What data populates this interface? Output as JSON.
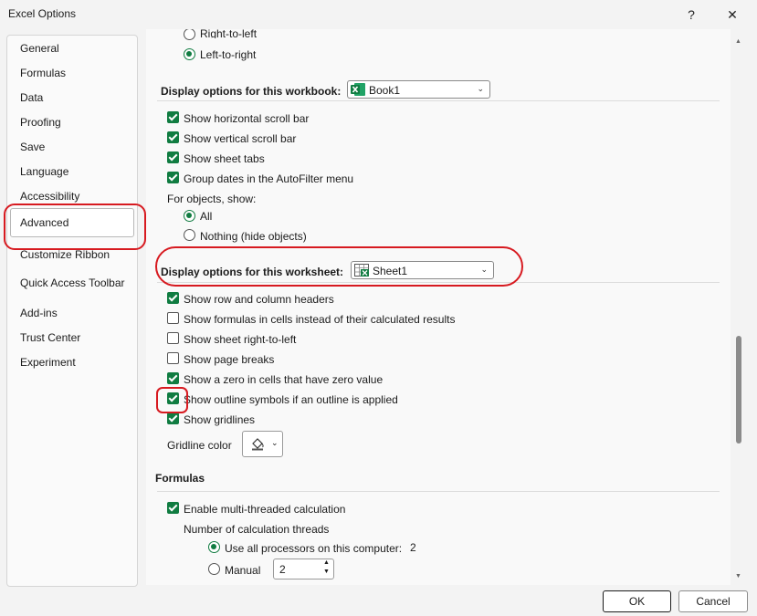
{
  "window": {
    "title": "Excel Options",
    "help": "?",
    "close": "✕"
  },
  "nav": {
    "items": [
      {
        "label": "General"
      },
      {
        "label": "Formulas"
      },
      {
        "label": "Data"
      },
      {
        "label": "Proofing"
      },
      {
        "label": "Save"
      },
      {
        "label": "Language"
      },
      {
        "label": "Accessibility"
      },
      {
        "label": "Advanced",
        "selected": true
      },
      {
        "label": "Customize Ribbon"
      },
      {
        "label": "Quick Access Toolbar"
      },
      {
        "label": "Add-ins"
      },
      {
        "label": "Trust Center"
      },
      {
        "label": "Experiment"
      }
    ]
  },
  "direction": {
    "right_to_left": "Right-to-left",
    "left_to_right": "Left-to-right",
    "selected": "Left-to-right"
  },
  "workbook": {
    "heading": "Display options for this workbook:",
    "combo_value": "Book1",
    "options": [
      {
        "label": "Show horizontal scroll bar",
        "checked": true
      },
      {
        "label": "Show vertical scroll bar",
        "checked": true
      },
      {
        "label": "Show sheet tabs",
        "checked": true
      },
      {
        "label": "Group dates in the AutoFilter menu",
        "checked": true
      }
    ],
    "objects_label": "For objects, show:",
    "objects_all": "All",
    "objects_nothing": "Nothing (hide objects)",
    "objects_selected": "All"
  },
  "worksheet": {
    "heading": "Display options for this worksheet:",
    "combo_value": "Sheet1",
    "options": [
      {
        "label": "Show row and column headers",
        "checked": true
      },
      {
        "label": "Show formulas in cells instead of their calculated results",
        "checked": false
      },
      {
        "label": "Show sheet right-to-left",
        "checked": false
      },
      {
        "label": "Show page breaks",
        "checked": false
      },
      {
        "label": "Show a zero in cells that have zero value",
        "checked": true
      },
      {
        "label": "Show outline symbols if an outline is applied",
        "checked": true
      },
      {
        "label": "Show gridlines",
        "checked": true
      }
    ],
    "gridline_color_label": "Gridline color"
  },
  "formulas": {
    "heading": "Formulas",
    "multithread_label": "Enable multi-threaded calculation",
    "multithread_checked": true,
    "threads_label": "Number of calculation threads",
    "all_processors_label": "Use all processors on this computer:",
    "processor_count": "2",
    "manual_label": "Manual",
    "manual_value": "2",
    "selected": "all"
  },
  "buttons": {
    "ok": "OK",
    "cancel": "Cancel"
  },
  "colors": {
    "accent": "#107c41",
    "annotation": "#d71a20"
  }
}
